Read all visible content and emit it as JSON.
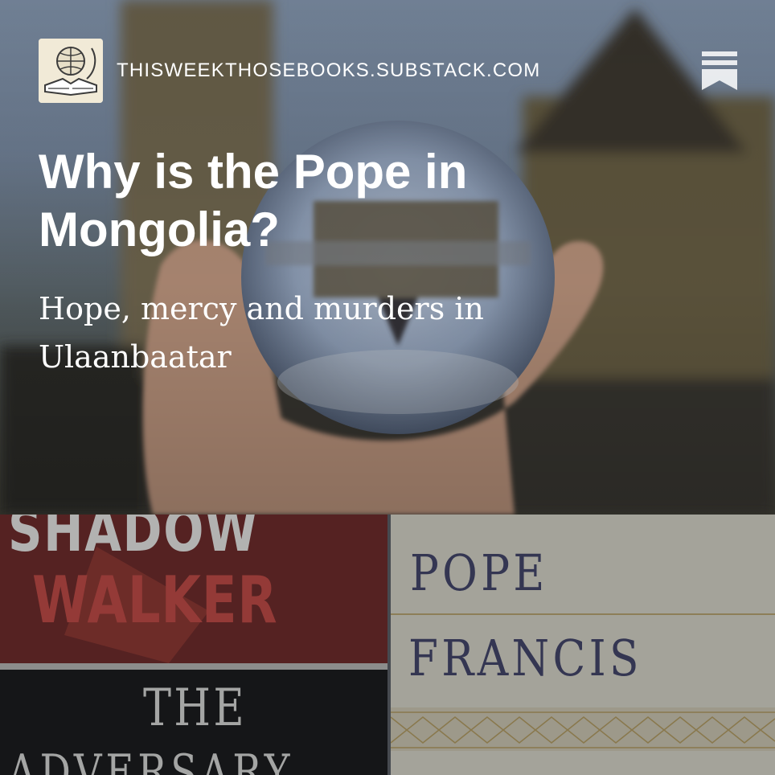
{
  "header": {
    "publication_domain": "THISWEEKTHOSEBOOKS.SUBSTACK.COM",
    "logo_icon": "globe-and-books-logo",
    "bookmark_icon": "bookmark-icon"
  },
  "article": {
    "title": "Why is the Pope in Mongolia?",
    "subtitle": "Hope, mercy and murders in Ulaanbaatar"
  },
  "covers": {
    "left": {
      "line1": "SHADOW",
      "line2": "WALKER",
      "line3": "THE",
      "line4": "ADVERSARY"
    },
    "right": {
      "line1": "POPE",
      "line2": "FRANCIS"
    }
  },
  "colors": {
    "title_text": "#ffffff",
    "walker_red": "#c2453d",
    "pope_francis_navy": "#3d3f63"
  }
}
